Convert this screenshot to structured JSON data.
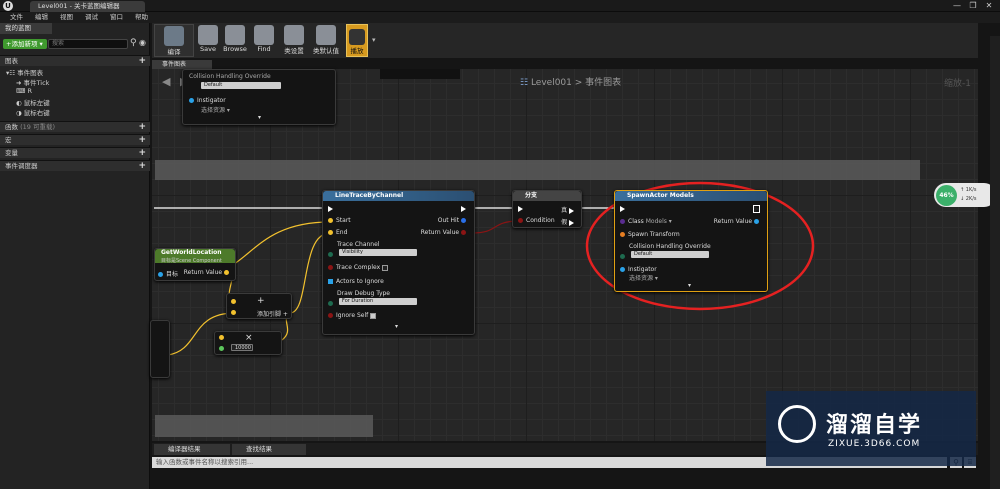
{
  "window": {
    "tab_title": "Level001 - 关卡蓝图编辑器",
    "minimize": "—",
    "maximize": "❐",
    "close": "✕"
  },
  "menu": [
    "文件",
    "编辑",
    "视图",
    "调试",
    "窗口",
    "帮助"
  ],
  "left_panel": {
    "tab": "我的蓝图",
    "add_button": "+添加新项 ▾",
    "search_placeholder": "搜索",
    "sections": {
      "graphs": "图表",
      "functions": "函数",
      "functions_count": "(19 可重载)",
      "macros": "宏",
      "variables": "变量",
      "dispatchers": "事件调度器"
    },
    "tree": [
      "事件图表",
      "事件Tick",
      "R",
      "鼠标左键",
      "鼠标右键"
    ]
  },
  "toolbar": [
    {
      "label": "编译"
    },
    {
      "label": "Save"
    },
    {
      "label": "Browse"
    },
    {
      "label": "Find"
    },
    {
      "label": "类设置"
    },
    {
      "label": "类默认值"
    },
    {
      "label": "播放"
    }
  ],
  "graph": {
    "tab": "事件图表",
    "breadcrumb": "Level001 > 事件图表",
    "zoom": "缩放-1"
  },
  "nodes": {
    "top_partial": {
      "collision_label": "Collision Handling Override",
      "collision_value": "Default",
      "instigator": "Instigator",
      "instigator_value": "选择资源 ▾"
    },
    "line_trace": {
      "title": "LineTraceByChannel",
      "start": "Start",
      "end": "End",
      "out_hit": "Out Hit",
      "return_value": "Return Value",
      "trace_channel": "Trace Channel",
      "trace_channel_value": "Visibility",
      "trace_complex": "Trace Complex",
      "actors_to_ignore": "Actors to Ignore",
      "draw_debug_type": "Draw Debug Type",
      "draw_debug_value": "For Duration",
      "ignore_self": "Ignore Self"
    },
    "branch": {
      "title": "分支",
      "condition": "Condition",
      "true": "真",
      "false": "假"
    },
    "spawn_actor": {
      "title": "SpawnActor Models",
      "class": "Class",
      "class_value": "Models ▾",
      "return_value": "Return Value",
      "spawn_transform": "Spawn Transform",
      "collision_label": "Collision Handling Override",
      "collision_value": "Default",
      "instigator": "Instigator",
      "instigator_value": "选择资源 ▾"
    },
    "get_world_location": {
      "title": "GetWorldLocation",
      "subtitle": "目标是Scene Component",
      "target": "目标",
      "return_value": "Return Value"
    },
    "add": {
      "symbol": "+",
      "label": "添加引脚 +"
    },
    "multiply": {
      "symbol": "×",
      "value": "10000"
    }
  },
  "bottom": {
    "tab1": "编译器结果",
    "tab2": "查找结果",
    "command_placeholder": "输入函数或事件名称以搜索引用..."
  },
  "perf_widget": {
    "percent": "46%",
    "up": "1K/s",
    "down": "2K/s"
  },
  "watermark": {
    "title": "溜溜自学",
    "url": "ZIXUE.3D66.COM"
  },
  "colors": {
    "exec": "#ffffff",
    "vector": "#f2c12e",
    "bool": "#8b1414",
    "object": "#2aa2e8",
    "class": "#5a2d91",
    "highlight": "#e52121",
    "selected_border": "#e0a012"
  }
}
